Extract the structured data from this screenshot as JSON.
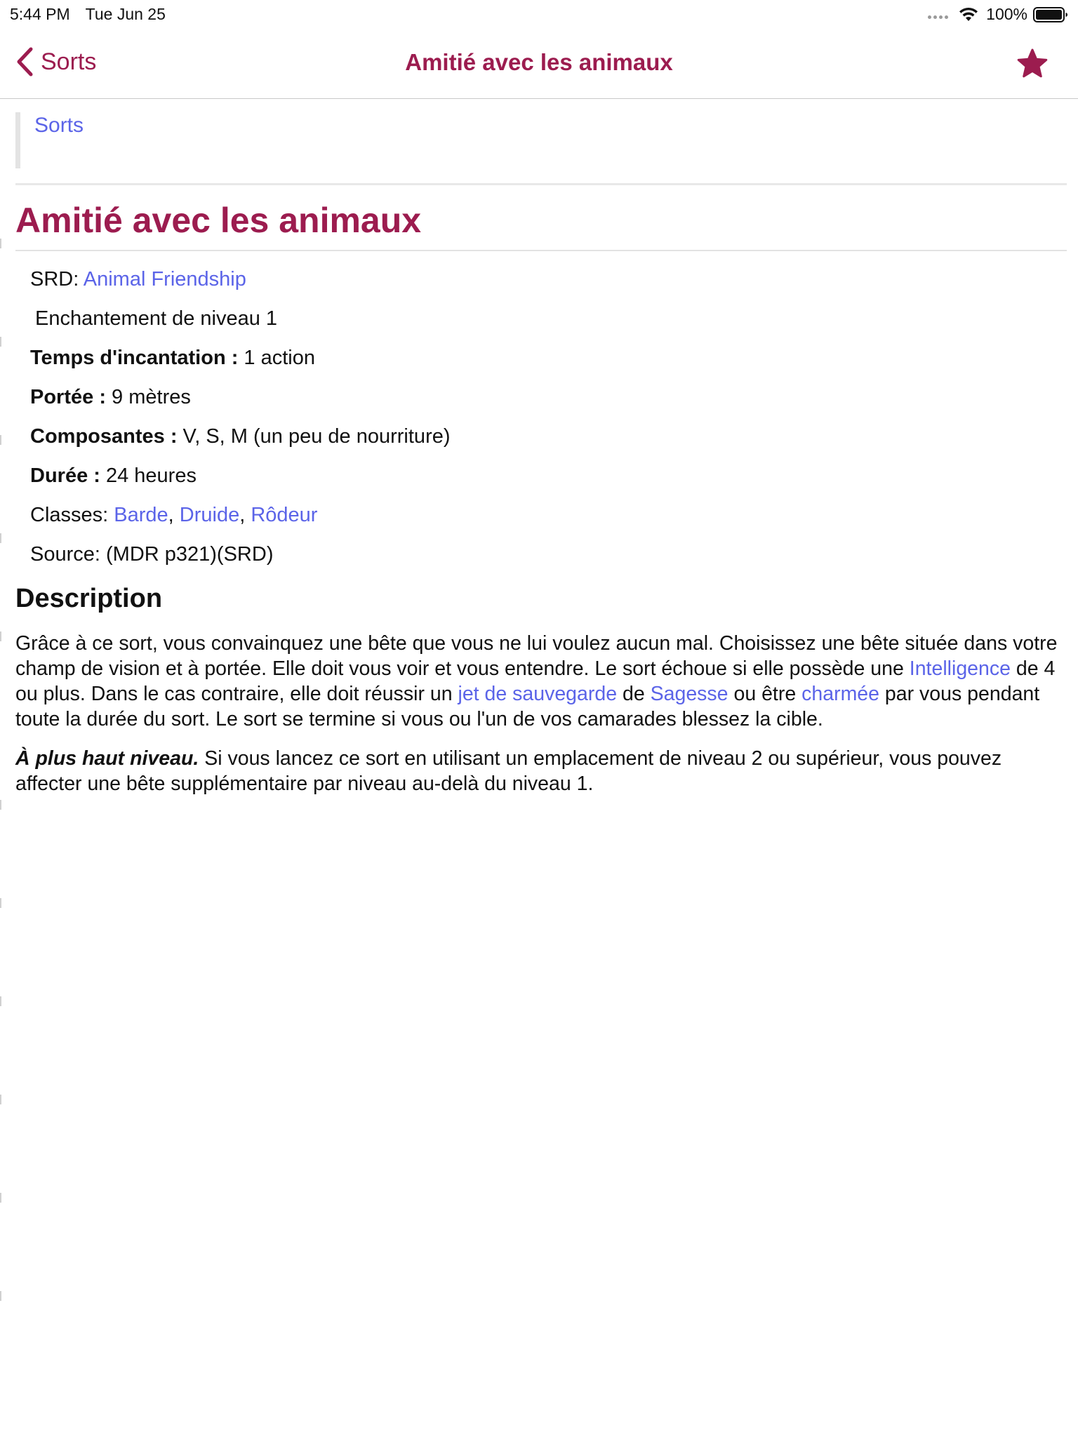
{
  "status_bar": {
    "time": "5:44 PM",
    "date": "Tue Jun 25",
    "battery_percent": "100%",
    "battery_level": 1.0,
    "icons": [
      "cellular-dots-icon",
      "wifi-icon",
      "battery-icon"
    ]
  },
  "nav": {
    "back_label": "Sorts",
    "title": "Amitié avec les animaux",
    "favorite_icon": "star-icon",
    "favorite_active": true
  },
  "colors": {
    "accent": "#9c1c4f",
    "link": "#5b64e8",
    "text": "#111111"
  },
  "breadcrumb": {
    "link": "Sorts"
  },
  "spell": {
    "title": "Amitié avec les animaux",
    "srd_label": "SRD: ",
    "srd_link": "Animal Friendship",
    "school": "Enchantement de niveau 1",
    "casting_time_label": "Temps d'incantation :",
    "casting_time_value": " 1 action",
    "range_label": "Portée :",
    "range_value": " 9 mètres",
    "components_label": "Composantes :",
    "components_value": " V, S, M (un peu de nourriture)",
    "duration_label": "Durée :",
    "duration_value": " 24 heures",
    "classes_label": "Classes: ",
    "classes": [
      "Barde",
      "Druide",
      "Rôdeur"
    ],
    "class_separator": ", ",
    "source": "Source: (MDR p321)(SRD)"
  },
  "description": {
    "heading": "Description",
    "p1_t1": "Grâce à ce sort, vous convainquez une bête que vous ne lui voulez aucun mal. Choisissez une bête située dans votre champ de vision et à portée. Elle doit vous voir et vous entendre. Le sort échoue si elle possède une ",
    "p1_link1": "Intelligence",
    "p1_t2": " de 4 ou plus. Dans le cas contraire, elle doit réussir un ",
    "p1_link2": "jet de sauvegarde",
    "p1_t3": " de ",
    "p1_link3": "Sagesse",
    "p1_t4": " ou être ",
    "p1_link4": "charmée",
    "p1_t5": " par vous pendant toute la durée du sort. Le sort se termine si vous ou l'un de vos camarades blessez la cible.",
    "p2_bold": "À plus haut niveau.",
    "p2_text": " Si vous lancez ce sort en utilisant un emplacement de niveau 2 ou supérieur, vous pouvez affecter une bête supplémentaire par niveau au-delà du niveau 1."
  }
}
